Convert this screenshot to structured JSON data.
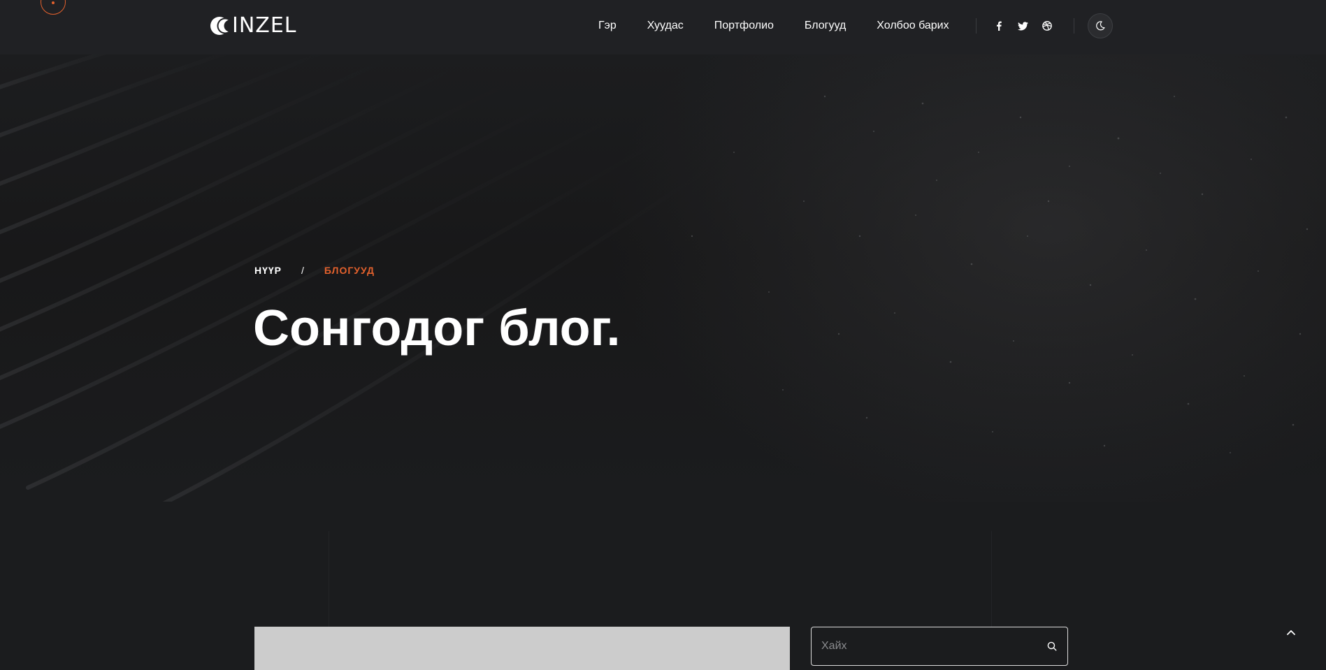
{
  "header": {
    "logo_text": "INZEL",
    "nav": [
      "Гэр",
      "Хуудас",
      "Портфолио",
      "Блогууд",
      "Холбоо барих"
    ],
    "social_icons": [
      "facebook-icon",
      "twitter-icon",
      "dribbble-icon"
    ],
    "theme_toggle_icon": "moon-icon"
  },
  "hero": {
    "breadcrumb": {
      "home": "НҮҮР",
      "separator": "/",
      "current": "БЛОГУУД"
    },
    "title": "Сонгодог блог."
  },
  "sidebar": {
    "search_placeholder": "Хайх",
    "search_icon": "search-icon"
  },
  "colors": {
    "accent": "#e3612d",
    "background": "#1b1c1e",
    "header_bg": "#202124",
    "text": "#ffffff",
    "thumbnail_placeholder": "#cccccc"
  }
}
